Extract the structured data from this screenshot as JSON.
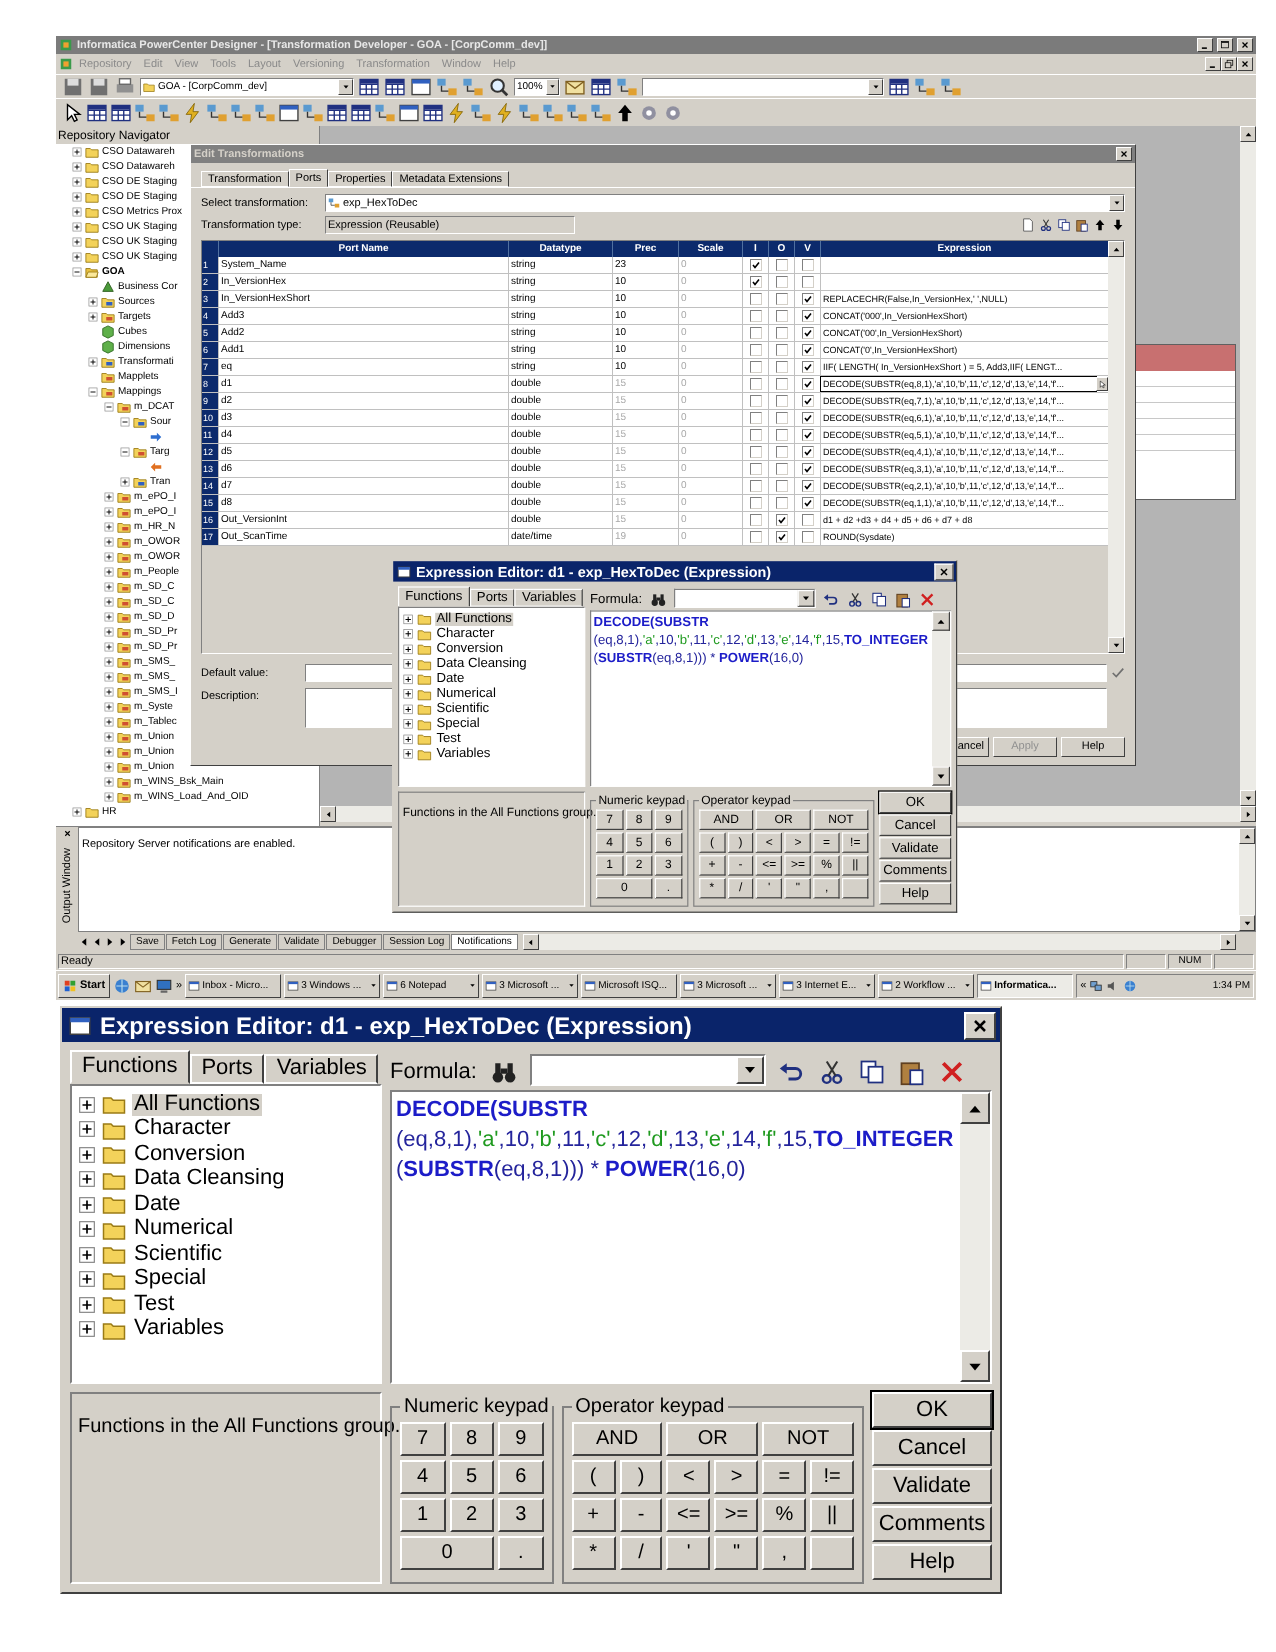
{
  "main_window": {
    "title": "Informatica PowerCenter Designer - [Transformation Developer - GOA - [CorpComm_dev]]",
    "menu": [
      {
        "label": "Repository",
        "disabled": true
      },
      {
        "label": "Edit",
        "disabled": true
      },
      {
        "label": "View",
        "disabled": true
      },
      {
        "label": "Tools",
        "disabled": true
      },
      {
        "label": "Layout",
        "disabled": true
      },
      {
        "label": "Versioning",
        "disabled": true
      },
      {
        "label": "Transformation",
        "disabled": true
      },
      {
        "label": "Window",
        "disabled": true
      },
      {
        "label": "Help",
        "disabled": true
      }
    ],
    "folder_dropdown": "GOA - [CorpComm_dev]",
    "zoom_dropdown": "100%",
    "navigator": {
      "title": "Repository Navigator",
      "tree": [
        {
          "label": "CSO Datawareh",
          "kind": "folder",
          "expanded": false
        },
        {
          "label": "CSO Datawareh",
          "kind": "folder",
          "expanded": false
        },
        {
          "label": "CSO DE Staging",
          "kind": "folder",
          "expanded": false
        },
        {
          "label": "CSO DE Staging",
          "kind": "folder",
          "expanded": false
        },
        {
          "label": "CSO Metrics Prox",
          "kind": "folder",
          "expanded": false
        },
        {
          "label": "CSO UK Staging",
          "kind": "folder",
          "expanded": false
        },
        {
          "label": "CSO UK Staging",
          "kind": "folder",
          "expanded": false
        },
        {
          "label": "CSO UK Staging",
          "kind": "folder",
          "expanded": false
        },
        {
          "label": "GOA",
          "kind": "open_folder",
          "expanded": true,
          "children": [
            {
              "label": "Business Cor",
              "kind": "business",
              "leaf": true
            },
            {
              "label": "Sources",
              "kind": "sources",
              "expanded": false
            },
            {
              "label": "Targets",
              "kind": "targets",
              "expanded": false
            },
            {
              "label": "Cubes",
              "kind": "cube",
              "leaf": true
            },
            {
              "label": "Dimensions",
              "kind": "dimension",
              "leaf": true
            },
            {
              "label": "Transformati",
              "kind": "transformations",
              "expanded": false
            },
            {
              "label": "Mapplets",
              "kind": "mapplets",
              "leaf": true
            },
            {
              "label": "Mappings",
              "kind": "mappings",
              "expanded": true,
              "children": [
                {
                  "label": "m_DCAT",
                  "kind": "mapping",
                  "expanded": true,
                  "children": [
                    {
                      "label": "Sour",
                      "kind": "sources",
                      "expanded": true,
                      "children": [
                        {
                          "kind": "source",
                          "leaf": true
                        }
                      ]
                    },
                    {
                      "label": "Targ",
                      "kind": "targets",
                      "expanded": true,
                      "children": [
                        {
                          "kind": "target",
                          "leaf": true
                        }
                      ]
                    },
                    {
                      "label": "Tran",
                      "kind": "transformations",
                      "expanded": false
                    }
                  ]
                },
                {
                  "label": "m_ePO_I",
                  "kind": "mapping",
                  "expanded": false
                },
                {
                  "label": "m_ePO_I",
                  "kind": "mapping",
                  "expanded": false
                },
                {
                  "label": "m_HR_N",
                  "kind": "mapping",
                  "expanded": false
                },
                {
                  "label": "m_OWOR",
                  "kind": "mapping",
                  "expanded": false
                },
                {
                  "label": "m_OWOR",
                  "kind": "mapping",
                  "expanded": false
                },
                {
                  "label": "m_People",
                  "kind": "mapping",
                  "expanded": false
                },
                {
                  "label": "m_SD_C",
                  "kind": "mapping",
                  "expanded": false
                },
                {
                  "label": "m_SD_C",
                  "kind": "mapping",
                  "expanded": false
                },
                {
                  "label": "m_SD_D",
                  "kind": "mapping",
                  "expanded": false
                },
                {
                  "label": "m_SD_Pr",
                  "kind": "mapping",
                  "expanded": false
                },
                {
                  "label": "m_SD_Pr",
                  "kind": "mapping",
                  "expanded": false
                },
                {
                  "label": "m_SMS_",
                  "kind": "mapping",
                  "expanded": false
                },
                {
                  "label": "m_SMS_",
                  "kind": "mapping",
                  "expanded": false
                },
                {
                  "label": "m_SMS_I",
                  "kind": "mapping",
                  "expanded": false
                },
                {
                  "label": "m_Syste",
                  "kind": "mapping",
                  "expanded": false
                },
                {
                  "label": "m_Tablec",
                  "kind": "mapping",
                  "expanded": false
                },
                {
                  "label": "m_Union",
                  "kind": "mapping",
                  "expanded": false
                },
                {
                  "label": "m_Union",
                  "kind": "mapping",
                  "expanded": false
                },
                {
                  "label": "m_Union",
                  "kind": "mapping",
                  "expanded": false
                },
                {
                  "label": "m_WINS_Bsk_Main",
                  "kind": "mapping",
                  "expanded": false
                },
                {
                  "label": "m_WINS_Load_And_OID",
                  "kind": "mapping",
                  "expanded": false
                }
              ]
            }
          ]
        },
        {
          "label": "HR",
          "kind": "folder",
          "expanded": false
        }
      ]
    },
    "output": {
      "title": "Output Window",
      "message": "Repository Server notifications are enabled.",
      "tabs": [
        {
          "label": "Save",
          "selected": false
        },
        {
          "label": "Fetch Log",
          "selected": false
        },
        {
          "label": "Generate",
          "selected": false
        },
        {
          "label": "Validate",
          "selected": false
        },
        {
          "label": "Debugger",
          "selected": false
        },
        {
          "label": "Session Log",
          "selected": false
        },
        {
          "label": "Notifications",
          "selected": true
        }
      ]
    },
    "status_bar": {
      "text": "Ready",
      "indicator": "NUM"
    },
    "taskbar": {
      "start": "Start",
      "quick_launch_more": "»",
      "tasks": [
        {
          "label": "Inbox - Micro...",
          "group": false,
          "selected": false
        },
        {
          "label": "3 Windows ...",
          "group": true,
          "selected": false
        },
        {
          "label": "6 Notepad",
          "group": true,
          "selected": false
        },
        {
          "label": "3 Microsoft ...",
          "group": true,
          "selected": false
        },
        {
          "label": "Microsoft ISQ...",
          "group": false,
          "selected": false
        },
        {
          "label": "3 Microsoft ...",
          "group": true,
          "selected": false
        },
        {
          "label": "3 Internet E...",
          "group": true,
          "selected": false
        },
        {
          "label": "2 Workflow ...",
          "group": true,
          "selected": false
        },
        {
          "label": "Informatica...",
          "group": false,
          "selected": true
        }
      ],
      "tray_more": "«",
      "clock": "1:34 PM"
    }
  },
  "edit_transformations": {
    "title": "Edit Transformations",
    "tabs": [
      {
        "label": "Transformation",
        "selected": false
      },
      {
        "label": "Ports",
        "selected": true
      },
      {
        "label": "Properties",
        "selected": false
      },
      {
        "label": "Metadata Extensions",
        "selected": false
      }
    ],
    "select_label": "Select transformation:",
    "transformation": "exp_HexToDec",
    "type_label": "Transformation type:",
    "type": "Expression (Reusable)",
    "columns": [
      "Port Name",
      "Datatype",
      "Prec",
      "Scale",
      "I",
      "O",
      "V",
      "Expression"
    ],
    "rows": [
      {
        "num": "1",
        "name": "System_Name",
        "datatype": "string",
        "prec": "23",
        "prec_disabled": false,
        "scale": "0",
        "scale_disabled": true,
        "input": true,
        "output": false,
        "variable": false,
        "selected": false
      },
      {
        "num": "2",
        "name": "In_VersionHex",
        "datatype": "string",
        "prec": "10",
        "prec_disabled": false,
        "scale": "0",
        "scale_disabled": true,
        "input": true,
        "output": false,
        "variable": false,
        "selected": false
      },
      {
        "num": "3",
        "name": "In_VersionHexShort",
        "datatype": "string",
        "prec": "10",
        "prec_disabled": false,
        "scale": "0",
        "scale_disabled": true,
        "input": false,
        "output": false,
        "variable": true,
        "expression": "REPLACECHR(False,In_VersionHex,' ',NULL)",
        "selected": false
      },
      {
        "num": "4",
        "name": "Add3",
        "datatype": "string",
        "prec": "10",
        "prec_disabled": false,
        "scale": "0",
        "scale_disabled": true,
        "input": false,
        "output": false,
        "variable": true,
        "expression": "CONCAT('000',In_VersionHexShort)",
        "selected": false
      },
      {
        "num": "5",
        "name": "Add2",
        "datatype": "string",
        "prec": "10",
        "prec_disabled": false,
        "scale": "0",
        "scale_disabled": true,
        "input": false,
        "output": false,
        "variable": true,
        "expression": "CONCAT('00',In_VersionHexShort)",
        "selected": false
      },
      {
        "num": "6",
        "name": "Add1",
        "datatype": "string",
        "prec": "10",
        "prec_disabled": false,
        "scale": "0",
        "scale_disabled": true,
        "input": false,
        "output": false,
        "variable": true,
        "expression": "CONCAT('0',In_VersionHexShort)",
        "selected": false
      },
      {
        "num": "7",
        "name": "eq",
        "datatype": "string",
        "prec": "10",
        "prec_disabled": false,
        "scale": "0",
        "scale_disabled": true,
        "input": false,
        "output": false,
        "variable": true,
        "expression": "IIF( LENGTH( In_VersionHexShort ) = 5, Add3,IIF( LENGT...",
        "selected": false
      },
      {
        "num": "8",
        "name": "d1",
        "datatype": "double",
        "prec": "15",
        "prec_disabled": true,
        "scale": "0",
        "scale_disabled": true,
        "input": false,
        "output": false,
        "variable": true,
        "expression": "DECODE(SUBSTR(eq,8,1),'a',10,'b',11,'c',12,'d',13,'e',14,'f'...",
        "selected": true
      },
      {
        "num": "9",
        "name": "d2",
        "datatype": "double",
        "prec": "15",
        "prec_disabled": true,
        "scale": "0",
        "scale_disabled": true,
        "input": false,
        "output": false,
        "variable": true,
        "expression": "DECODE(SUBSTR(eq,7,1),'a',10,'b',11,'c',12,'d',13,'e',14,'f'...",
        "selected": false
      },
      {
        "num": "10",
        "name": "d3",
        "datatype": "double",
        "prec": "15",
        "prec_disabled": true,
        "scale": "0",
        "scale_disabled": true,
        "input": false,
        "output": false,
        "variable": true,
        "expression": "DECODE(SUBSTR(eq,6,1),'a',10,'b',11,'c',12,'d',13,'e',14,'f'...",
        "selected": false
      },
      {
        "num": "11",
        "name": "d4",
        "datatype": "double",
        "prec": "15",
        "prec_disabled": true,
        "scale": "0",
        "scale_disabled": true,
        "input": false,
        "output": false,
        "variable": true,
        "expression": "DECODE(SUBSTR(eq,5,1),'a',10,'b',11,'c',12,'d',13,'e',14,'f'...",
        "selected": false
      },
      {
        "num": "12",
        "name": "d5",
        "datatype": "double",
        "prec": "15",
        "prec_disabled": true,
        "scale": "0",
        "scale_disabled": true,
        "input": false,
        "output": false,
        "variable": true,
        "expression": "DECODE(SUBSTR(eq,4,1),'a',10,'b',11,'c',12,'d',13,'e',14,'f'...",
        "selected": false
      },
      {
        "num": "13",
        "name": "d6",
        "datatype": "double",
        "prec": "15",
        "prec_disabled": true,
        "scale": "0",
        "scale_disabled": true,
        "input": false,
        "output": false,
        "variable": true,
        "expression": "DECODE(SUBSTR(eq,3,1),'a',10,'b',11,'c',12,'d',13,'e',14,'f'...",
        "selected": false
      },
      {
        "num": "14",
        "name": "d7",
        "datatype": "double",
        "prec": "15",
        "prec_disabled": true,
        "scale": "0",
        "scale_disabled": true,
        "input": false,
        "output": false,
        "variable": true,
        "expression": "DECODE(SUBSTR(eq,2,1),'a',10,'b',11,'c',12,'d',13,'e',14,'f'...",
        "selected": false
      },
      {
        "num": "15",
        "name": "d8",
        "datatype": "double",
        "prec": "15",
        "prec_disabled": true,
        "scale": "0",
        "scale_disabled": true,
        "input": false,
        "output": false,
        "variable": true,
        "expression": "DECODE(SUBSTR(eq,1,1),'a',10,'b',11,'c',12,'d',13,'e',14,'f'...",
        "selected": false
      },
      {
        "num": "16",
        "name": "Out_VersionInt",
        "datatype": "double",
        "prec": "15",
        "prec_disabled": true,
        "scale": "0",
        "scale_disabled": true,
        "input": false,
        "output": true,
        "variable": false,
        "expression": "d1 + d2 +d3 + d4 + d5 + d6 + d7 + d8",
        "selected": false
      },
      {
        "num": "17",
        "name": "Out_ScanTime",
        "datatype": "date/time",
        "prec": "19",
        "prec_disabled": true,
        "scale": "0",
        "scale_disabled": true,
        "input": false,
        "output": true,
        "variable": false,
        "expression": "ROUND(Sysdate)",
        "selected": false
      }
    ],
    "default_label": "Default value:",
    "description_label": "Description:",
    "buttons": [
      {
        "label": "ancel",
        "disabled": false
      },
      {
        "label": "Apply",
        "disabled": true
      },
      {
        "label": "Help",
        "disabled": false
      }
    ]
  },
  "expression_editor_small": {
    "title": "Expression Editor: d1 - exp_HexToDec (Expression)",
    "tabs": [
      {
        "label": "Functions",
        "selected": true
      },
      {
        "label": "Ports",
        "selected": false
      },
      {
        "label": "Variables",
        "selected": false
      }
    ],
    "functions": [
      {
        "label": "All Functions",
        "selected": true
      },
      {
        "label": "Character",
        "selected": false
      },
      {
        "label": "Conversion",
        "selected": false
      },
      {
        "label": "Data Cleansing",
        "selected": false
      },
      {
        "label": "Date",
        "selected": false
      },
      {
        "label": "Numerical",
        "selected": false
      },
      {
        "label": "Scientific",
        "selected": false
      },
      {
        "label": "Special",
        "selected": false
      },
      {
        "label": "Test",
        "selected": false
      },
      {
        "label": "Variables",
        "selected": false
      }
    ],
    "status": "Functions in the All Functions group.",
    "formula_label": "Formula:",
    "formula": [
      [
        {
          "kind": "keyword",
          "text": "DECODE(SUBSTR"
        }
      ],
      [
        {
          "kind": "text",
          "text": "(eq,8,1),"
        },
        {
          "kind": "string",
          "text": "'a'"
        },
        {
          "kind": "text",
          "text": ",10,"
        },
        {
          "kind": "string",
          "text": "'b'"
        },
        {
          "kind": "text",
          "text": ",11,"
        },
        {
          "kind": "string",
          "text": "'c'"
        },
        {
          "kind": "text",
          "text": ",12,"
        },
        {
          "kind": "string",
          "text": "'d'"
        },
        {
          "kind": "text",
          "text": ",13,"
        },
        {
          "kind": "string",
          "text": "'e'"
        },
        {
          "kind": "text",
          "text": ",14,"
        },
        {
          "kind": "string",
          "text": "'f'"
        },
        {
          "kind": "text",
          "text": ",15,"
        },
        {
          "kind": "keyword",
          "text": "TO_INTEGER"
        }
      ],
      [
        {
          "kind": "text",
          "text": "("
        },
        {
          "kind": "keyword",
          "text": "SUBSTR"
        },
        {
          "kind": "text",
          "text": "(eq,8,1))) * "
        },
        {
          "kind": "keyword",
          "text": "POWER"
        },
        {
          "kind": "text",
          "text": "(16,0)"
        }
      ]
    ],
    "numeric_keypad": {
      "title": "Numeric keypad",
      "keys": [
        "7",
        "8",
        "9",
        "4",
        "5",
        "6",
        "1",
        "2",
        "3",
        "0",
        "."
      ]
    },
    "operator_keypad": {
      "title": "Operator keypad",
      "keys": [
        "AND",
        "OR",
        "NOT",
        "(",
        ")",
        "<",
        ">",
        "=",
        "!=",
        "+",
        "-",
        "<=",
        ">=",
        "%",
        "||",
        "*",
        "/",
        "'",
        "\"",
        ","
      ]
    },
    "buttons": [
      "OK",
      "Cancel",
      "Validate",
      "Comments",
      "Help"
    ]
  },
  "expression_editor": {
    "title": "Expression Editor: d1 - exp_HexToDec (Expression)",
    "tabs": [
      {
        "label": "Functions",
        "selected": true
      },
      {
        "label": "Ports",
        "selected": false
      },
      {
        "label": "Variables",
        "selected": false
      }
    ],
    "functions": [
      {
        "label": "All Functions",
        "selected": true
      },
      {
        "label": "Character",
        "selected": false
      },
      {
        "label": "Conversion",
        "selected": false
      },
      {
        "label": "Data Cleansing",
        "selected": false
      },
      {
        "label": "Date",
        "selected": false
      },
      {
        "label": "Numerical",
        "selected": false
      },
      {
        "label": "Scientific",
        "selected": false
      },
      {
        "label": "Special",
        "selected": false
      },
      {
        "label": "Test",
        "selected": false
      },
      {
        "label": "Variables",
        "selected": false
      }
    ],
    "status": "Functions in the All Functions group.",
    "formula_label": "Formula:",
    "formula": [
      [
        {
          "kind": "keyword",
          "text": "DECODE(SUBSTR"
        }
      ],
      [
        {
          "kind": "text",
          "text": "(eq,8,1),"
        },
        {
          "kind": "string",
          "text": "'a'"
        },
        {
          "kind": "text",
          "text": ",10,"
        },
        {
          "kind": "string",
          "text": "'b'"
        },
        {
          "kind": "text",
          "text": ",11,"
        },
        {
          "kind": "string",
          "text": "'c'"
        },
        {
          "kind": "text",
          "text": ",12,"
        },
        {
          "kind": "string",
          "text": "'d'"
        },
        {
          "kind": "text",
          "text": ",13,"
        },
        {
          "kind": "string",
          "text": "'e'"
        },
        {
          "kind": "text",
          "text": ",14,"
        },
        {
          "kind": "string",
          "text": "'f'"
        },
        {
          "kind": "text",
          "text": ",15,"
        },
        {
          "kind": "keyword",
          "text": "TO_INTEGER"
        }
      ],
      [
        {
          "kind": "text",
          "text": "("
        },
        {
          "kind": "keyword",
          "text": "SUBSTR"
        },
        {
          "kind": "text",
          "text": "(eq,8,1))) * "
        },
        {
          "kind": "keyword",
          "text": "POWER"
        },
        {
          "kind": "text",
          "text": "(16,0)"
        }
      ]
    ],
    "numeric_keypad": {
      "title": "Numeric keypad",
      "keys": [
        "7",
        "8",
        "9",
        "4",
        "5",
        "6",
        "1",
        "2",
        "3",
        "0",
        "."
      ]
    },
    "operator_keypad": {
      "title": "Operator keypad",
      "keys": [
        "AND",
        "OR",
        "NOT",
        "(",
        ")",
        "<",
        ">",
        "=",
        "!=",
        "+",
        "-",
        "<=",
        ">=",
        "%",
        "||",
        "*",
        "/",
        "'",
        "\"",
        ","
      ]
    },
    "buttons": [
      "OK",
      "Cancel",
      "Validate",
      "Comments",
      "Help"
    ]
  }
}
